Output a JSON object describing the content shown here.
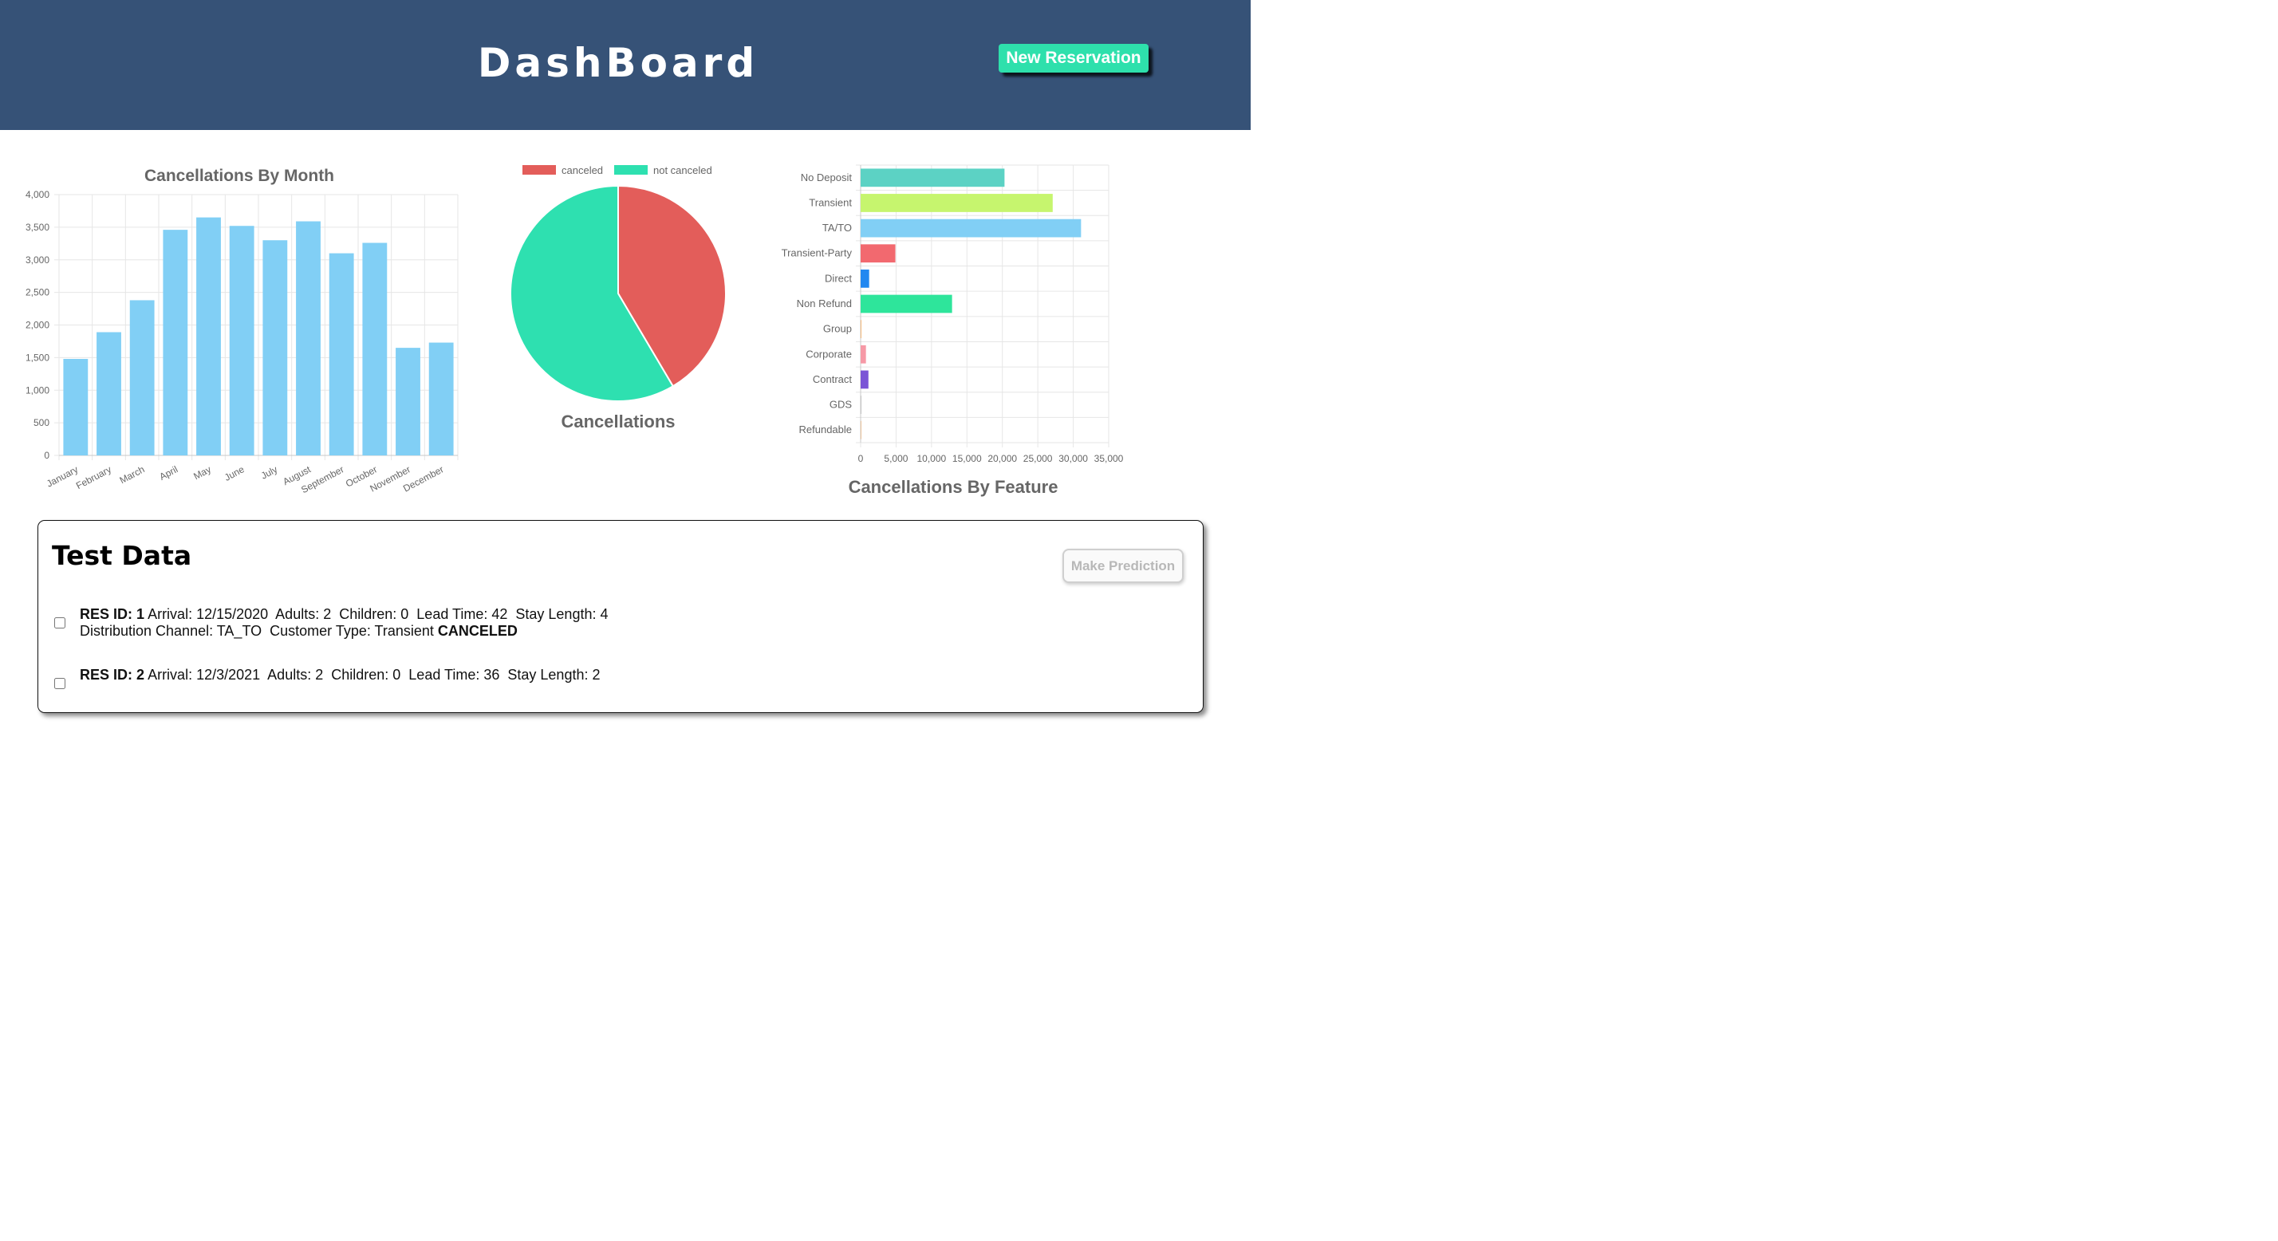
{
  "header": {
    "title": "DashBoard",
    "new_reservation_label": "New Reservation",
    "background": "#365277",
    "accent": "#2ee0ac"
  },
  "chart_data": [
    {
      "type": "bar",
      "title": "Cancellations By Month",
      "categories": [
        "January",
        "February",
        "March",
        "April",
        "May",
        "June",
        "July",
        "August",
        "September",
        "October",
        "November",
        "December"
      ],
      "values": [
        1480,
        1890,
        2380,
        3460,
        3650,
        3520,
        3300,
        3590,
        3100,
        3260,
        1650,
        1730
      ],
      "ylim": [
        0,
        4000
      ],
      "yticks": [
        "0",
        "500",
        "1,000",
        "1,500",
        "2,000",
        "2,500",
        "3,000",
        "3,500",
        "4,000"
      ],
      "color": "#81cff5",
      "grid": true
    },
    {
      "type": "pie",
      "title": "Cancellations",
      "labels": [
        "canceled",
        "not canceled"
      ],
      "values": [
        41.5,
        58.5
      ],
      "colors": [
        "#e35d5a",
        "#2ee0b0"
      ],
      "legend": "top"
    },
    {
      "type": "bar",
      "orientation": "horizontal",
      "title": "Cancellations By Feature",
      "categories": [
        "No Deposit",
        "Transient",
        "TA/TO",
        "Transient-Party",
        "Direct",
        "Non Refund",
        "Group",
        "Corporate",
        "Contract",
        "GDS",
        "Refundable"
      ],
      "values": [
        20300,
        27100,
        31100,
        4900,
        1200,
        12900,
        100,
        750,
        1100,
        0,
        50
      ],
      "colors": [
        "#5cd2c4",
        "#c6f56e",
        "#81cff5",
        "#f2696f",
        "#2288f0",
        "#2ee59b",
        "#f4b87a",
        "#f699a6",
        "#7b55d6",
        "#9a9a9a",
        "#e9c29b"
      ],
      "xlim": [
        0,
        35000
      ],
      "xticks": [
        "0",
        "5,000",
        "10,000",
        "15,000",
        "20,000",
        "25,000",
        "30,000",
        "35,000"
      ],
      "grid": true
    }
  ],
  "test_data": {
    "title": "Test Data",
    "predict_label": "Make Prediction",
    "records": [
      {
        "id_label": "RES ID:",
        "id": "1",
        "arrival": "Arrival: 12/15/2020",
        "adults": "Adults: 2",
        "children": "Children: 0",
        "lead_time": "Lead Time: 42",
        "stay_length": "Stay Length: 4",
        "channel": "Distribution Channel: TA_TO",
        "customer_type": "Customer Type: Transient",
        "status": "CANCELED"
      },
      {
        "id_label": "RES ID:",
        "id": "2",
        "arrival": "Arrival: 12/3/2021",
        "adults": "Adults: 2",
        "children": "Children: 0",
        "lead_time": "Lead Time: 36",
        "stay_length": "Stay Length: 2",
        "channel": "",
        "customer_type": "",
        "status": ""
      }
    ]
  }
}
